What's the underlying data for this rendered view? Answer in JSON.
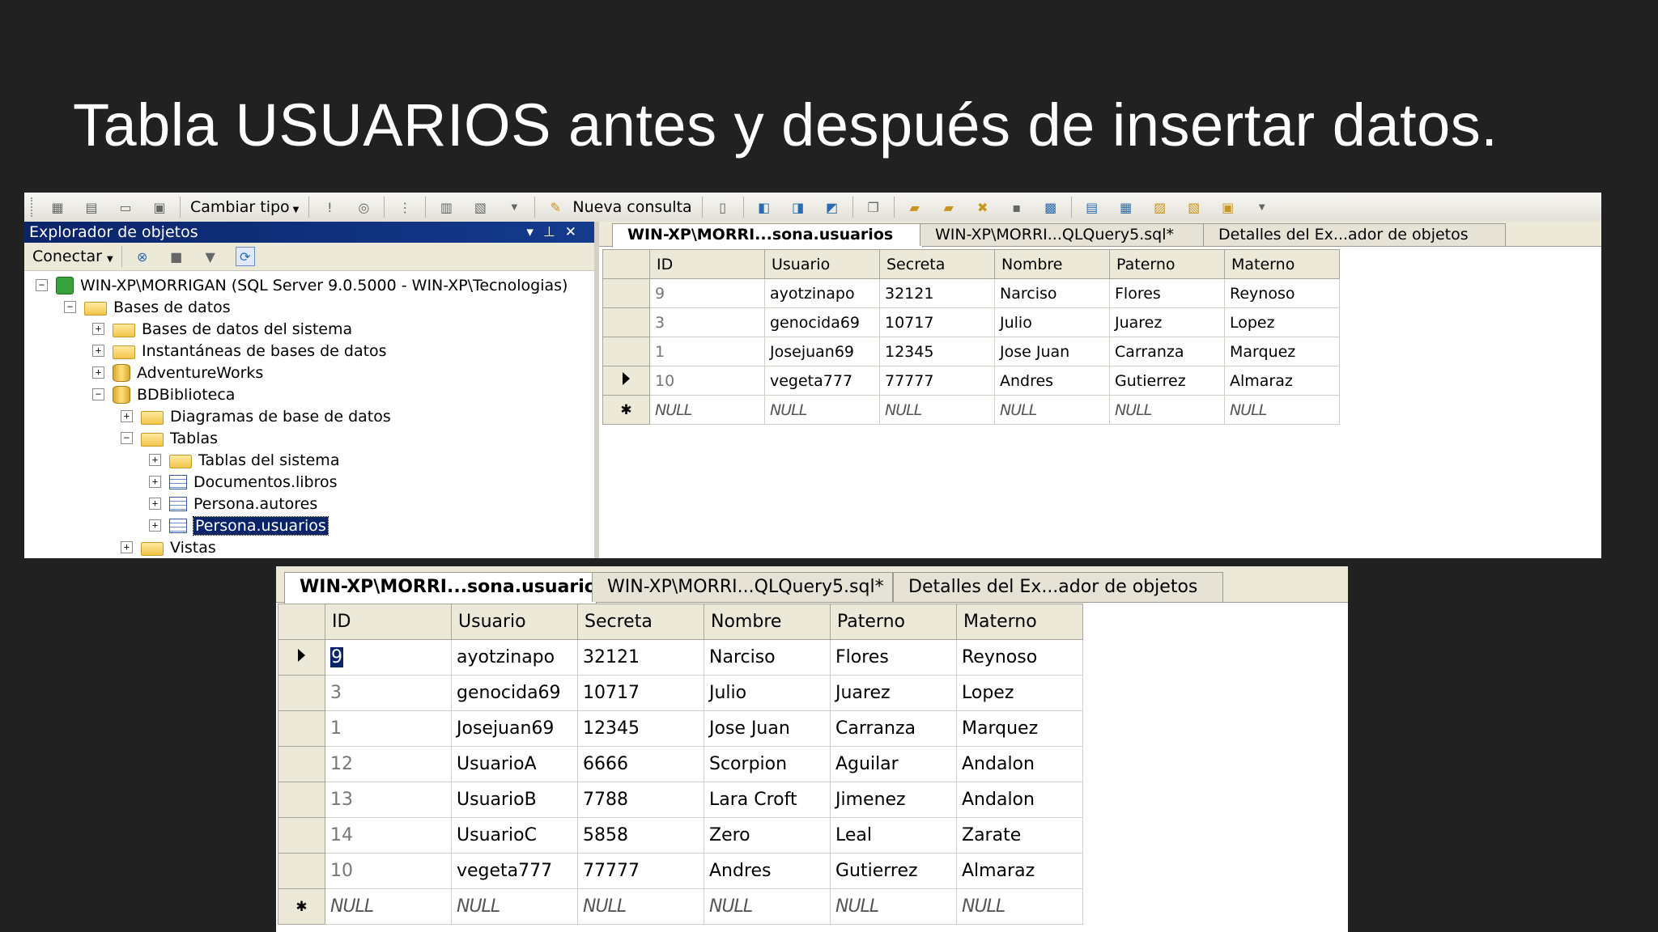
{
  "slide": {
    "title": "Tabla USUARIOS antes y después de insertar datos."
  },
  "toolbar": {
    "change_type": "Cambiar tipo",
    "new_query": "Nueva consulta"
  },
  "explorer": {
    "title": "Explorador de objetos",
    "connect": "Conectar",
    "tree": [
      {
        "label": "WIN-XP\\MORRIGAN (SQL Server 9.0.5000 - WIN-XP\\Tecnologias)",
        "icon": "server-icon",
        "exp": "−"
      },
      {
        "label": "Bases de datos",
        "icon": "folder-icon",
        "exp": "−"
      },
      {
        "label": "Bases de datos del sistema",
        "icon": "folder-icon",
        "exp": "+"
      },
      {
        "label": "Instantáneas de bases de datos",
        "icon": "folder-icon",
        "exp": "+"
      },
      {
        "label": "AdventureWorks",
        "icon": "database-icon",
        "exp": "+"
      },
      {
        "label": "BDBiblioteca",
        "icon": "database-icon",
        "exp": "−"
      },
      {
        "label": "Diagramas de base de datos",
        "icon": "folder-icon",
        "exp": "+"
      },
      {
        "label": "Tablas",
        "icon": "folder-icon",
        "exp": "−"
      },
      {
        "label": "Tablas del sistema",
        "icon": "folder-icon",
        "exp": "+"
      },
      {
        "label": "Documentos.libros",
        "icon": "table-icon",
        "exp": "+"
      },
      {
        "label": "Persona.autores",
        "icon": "table-icon",
        "exp": "+"
      },
      {
        "label": "Persona.usuarios",
        "icon": "table-icon",
        "exp": "+",
        "selected": true
      },
      {
        "label": "Vistas",
        "icon": "folder-icon",
        "exp": "+"
      }
    ]
  },
  "tabs": [
    {
      "label": "WIN-XP\\MORRI...sona.usuarios",
      "active": true
    },
    {
      "label": "WIN-XP\\MORRI...QLQuery5.sql*",
      "active": false
    },
    {
      "label": "Detalles del Ex...ador de objetos",
      "active": false
    }
  ],
  "columns": [
    "ID",
    "Usuario",
    "Secreta",
    "Nombre",
    "Paterno",
    "Materno"
  ],
  "grid_before": {
    "rows": [
      [
        "9",
        "ayotzinapo",
        "32121",
        "Narciso",
        "Flores",
        "Reynoso"
      ],
      [
        "3",
        "genocida69",
        "10717",
        "Julio",
        "Juarez",
        "Lopez"
      ],
      [
        "1",
        "Josejuan69",
        "12345",
        "Jose Juan",
        "Carranza",
        "Marquez"
      ],
      [
        "10",
        "vegeta777",
        "77777",
        "Andres",
        "Gutierrez",
        "Almaraz"
      ]
    ],
    "current_row": 3,
    "null_text": "NULL"
  },
  "grid_after": {
    "rows": [
      [
        "9",
        "ayotzinapo",
        "32121",
        "Narciso",
        "Flores",
        "Reynoso"
      ],
      [
        "3",
        "genocida69",
        "10717",
        "Julio",
        "Juarez",
        "Lopez"
      ],
      [
        "1",
        "Josejuan69",
        "12345",
        "Jose Juan",
        "Carranza",
        "Marquez"
      ],
      [
        "12",
        "UsuarioA",
        "6666",
        "Scorpion",
        "Aguilar",
        "Andalon"
      ],
      [
        "13",
        "UsuarioB",
        "7788",
        "Lara Croft",
        "Jimenez",
        "Andalon"
      ],
      [
        "14",
        "UsuarioC",
        "5858",
        "Zero",
        "Leal",
        "Zarate"
      ],
      [
        "10",
        "vegeta777",
        "77777",
        "Andres",
        "Gutierrez",
        "Almaraz"
      ]
    ],
    "current_row": 0,
    "null_text": "NULL"
  }
}
